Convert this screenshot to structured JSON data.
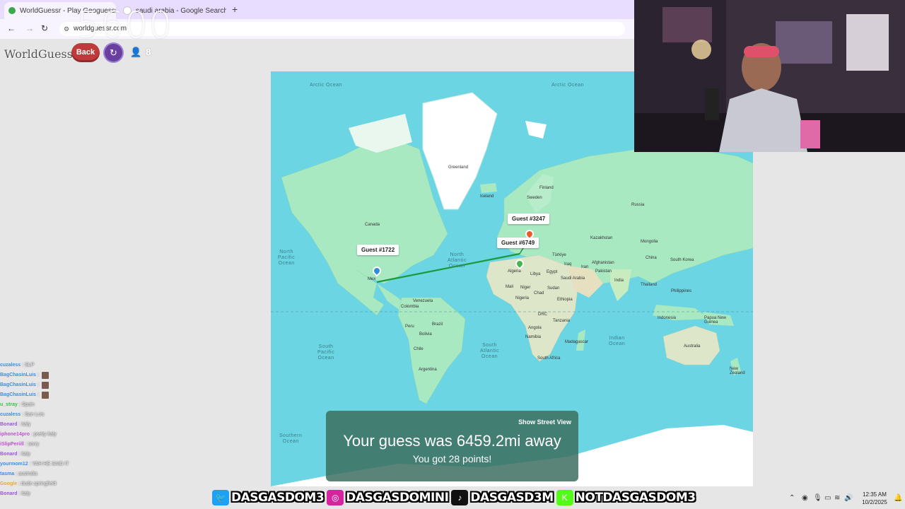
{
  "browser": {
    "tabs": [
      {
        "title": "WorldGuessr - Play Geoguessr",
        "active": true
      },
      {
        "title": "saudi arabia - Google Search",
        "active": false
      }
    ],
    "address": "worldguessr.com",
    "overlay_number": "5600"
  },
  "app": {
    "logo": "WorldGuessr",
    "back_label": "Back",
    "player_count": "8"
  },
  "map": {
    "oceans": {
      "arctic_left": "Arctic Ocean",
      "arctic_right": "Arctic Ocean",
      "north_pacific": "North\nPacific\nOcean",
      "north_atlantic": "North\nAtlantic\nOcean",
      "south_pacific": "South\nPacific\nOcean",
      "south_atlantic": "South\nAtlantic\nOcean",
      "indian": "Indian\nOcean",
      "southern": "Southern\nOcean"
    },
    "places": {
      "greenland": "Greenland",
      "iceland": "Iceland",
      "sweden": "Sweden",
      "finland": "Finland",
      "russia": "Russia",
      "canada": "Canada",
      "kazakhstan": "Kazakhstan",
      "mongolia": "Mongolia",
      "turkiye": "Türkiye",
      "china": "China",
      "iran": "Iran",
      "afghanistan": "Afghanistan",
      "pakistan": "Pakistan",
      "iraq": "Iraq",
      "india": "India",
      "saudi": "Saudi Arabia",
      "egypt": "Egypt",
      "libya": "Libya",
      "algeria": "Algeria",
      "mali": "Mali",
      "niger": "Niger",
      "chad": "Chad",
      "sudan": "Sudan",
      "nigeria": "Nigeria",
      "ethiopia": "Ethiopia",
      "drc": "DRC",
      "tanzania": "Tanzania",
      "angola": "Angola",
      "namibia": "Namibia",
      "south_africa": "South Africa",
      "madagascar": "Madagascar",
      "south_korea": "South Korea",
      "thailand": "Thailand",
      "philippines": "Philippines",
      "indonesia": "Indonesia",
      "png": "Papua New\nGuinea",
      "australia": "Australia",
      "new_zealand": "New\nZealand",
      "venezuela": "Venezuela",
      "colombia": "Colombia",
      "peru": "Peru",
      "bolivia": "Bolivia",
      "brazil": "Brazil",
      "chile": "Chile",
      "argentina": "Argentina",
      "mexico": "Mex"
    },
    "guests": [
      {
        "name": "Guest #3247",
        "color": "#e65c2e"
      },
      {
        "name": "Guest #6749",
        "color": "#42b84a"
      },
      {
        "name": "Guest #1722",
        "color": "#2f8fd6"
      }
    ],
    "result": {
      "street_view": "Show Street View",
      "guess_text": "Your guess was 6459.2mi away",
      "points_text": "You got 28 points!"
    }
  },
  "chat": [
    {
      "user": "cuzaless",
      "msg": ": SLP",
      "color": "#3a8ee6",
      "avatar": false
    },
    {
      "user": "BagChasinLuis",
      "msg": ":",
      "color": "#3a8ee6",
      "avatar": true
    },
    {
      "user": "BagChasinLuis",
      "msg": ":",
      "color": "#3a8ee6",
      "avatar": true
    },
    {
      "user": "BagChasinLuis",
      "msg": ":",
      "color": "#3a8ee6",
      "avatar": true
    },
    {
      "user": "u_stray",
      "msg": ": Spain",
      "color": "#3cc24a",
      "avatar": false
    },
    {
      "user": "cuzaless",
      "msg": ": San Luis",
      "color": "#3a8ee6",
      "avatar": false
    },
    {
      "user": "Bonard",
      "msg": ": Italy",
      "color": "#9a55e6",
      "avatar": false
    },
    {
      "user": "iphone14pro",
      "msg": ": pretty italy",
      "color": "#c04fd6",
      "avatar": false
    },
    {
      "user": "iSlipPeriill",
      "msg": ": sorry",
      "color": "#c04fd6",
      "avatar": false
    },
    {
      "user": "Bonard",
      "msg": ": italy",
      "color": "#9a55e6",
      "avatar": false
    },
    {
      "user": "yourmom12",
      "msg": ": YAH HE SAID IT",
      "color": "#3a8ee6",
      "avatar": false
    },
    {
      "user": "tasma",
      "msg": ": australia",
      "color": "#3a8ee6",
      "avatar": false
    },
    {
      "user": "Google",
      "msg": ": dude springfield",
      "color": "#e6a83a",
      "avatar": false
    },
    {
      "user": "Bonard",
      "msg": ": italy",
      "color": "#9a55e6",
      "avatar": false
    }
  ],
  "socials": [
    {
      "icon": "twitter-icon",
      "symbol": "🐦",
      "bg": "#1da1f2",
      "handle": "DASGASDOM3"
    },
    {
      "icon": "instagram-icon",
      "symbol": "◎",
      "bg": "#d6249f",
      "handle": "DASGASDOMINI"
    },
    {
      "icon": "tiktok-icon",
      "symbol": "♪",
      "bg": "#111111",
      "handle": "DASGASD3M"
    },
    {
      "icon": "kick-icon",
      "symbol": "K",
      "bg": "#53fc18",
      "handle": "NOTDASGASDOM3"
    }
  ],
  "tray": {
    "time": "12:35 AM",
    "date": "10/2/2025"
  }
}
